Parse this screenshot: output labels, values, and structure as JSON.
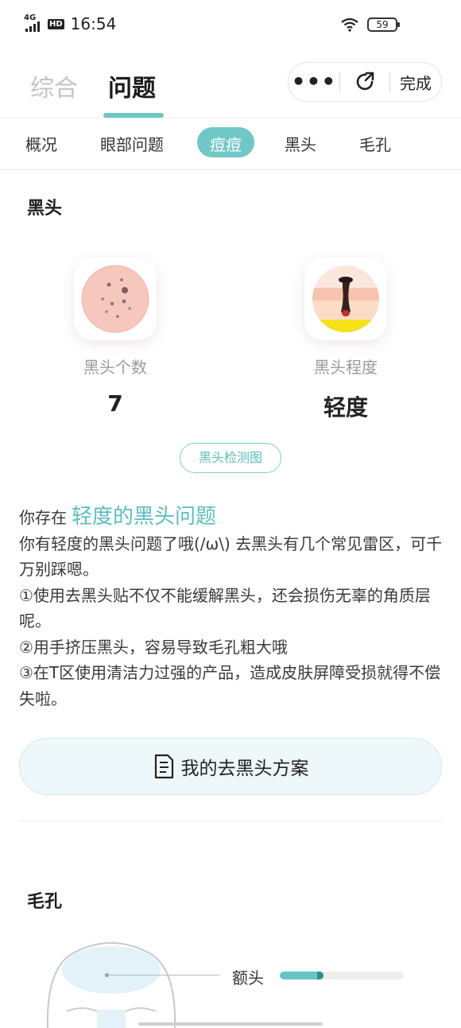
{
  "status_bar": {
    "network": "4G",
    "hd": "HD",
    "time": "16:54",
    "battery": "59"
  },
  "header": {
    "tabs": [
      {
        "label": "综合"
      },
      {
        "label": "问题"
      }
    ],
    "capsule": {
      "more": "•••",
      "done": "完成"
    }
  },
  "subtabs": [
    {
      "label": "概况"
    },
    {
      "label": "眼部问题"
    },
    {
      "label": "痘痘"
    },
    {
      "label": "黑头"
    },
    {
      "label": "毛孔"
    }
  ],
  "blackhead": {
    "title": "黑头",
    "count_label": "黑头个数",
    "count_value": "7",
    "degree_label": "黑头程度",
    "degree_value": "轻度",
    "detect_button": "黑头检测图",
    "lead": "你存在",
    "highlight": "轻度的黑头问题",
    "paragraphs": [
      "你有轻度的黑头问题了哦(/ω\\) 去黑头有几个常见雷区，可千万别踩嗯。",
      "①使用去黑头贴不仅不能缓解黑头，还会损伤无辜的角质层呢。",
      "②用手挤压黑头，容易导致毛孔粗大哦",
      "③在T区使用清洁力过强的产品，造成皮肤屏障受损就得不偿失啦。"
    ],
    "plan_button": "我的去黑头方案"
  },
  "pores": {
    "title": "毛孔",
    "zones": [
      {
        "label": "额头",
        "level": 0.35
      }
    ]
  },
  "colors": {
    "accent": "#6fc6c4",
    "accent_text": "#5dbdbc"
  },
  "icons": [
    "signal-icon",
    "wifi-icon",
    "battery-icon",
    "more-icon",
    "refresh-icon",
    "document-icon",
    "skin-dots-icon",
    "pore-blackhead-icon",
    "face-outline-icon"
  ]
}
